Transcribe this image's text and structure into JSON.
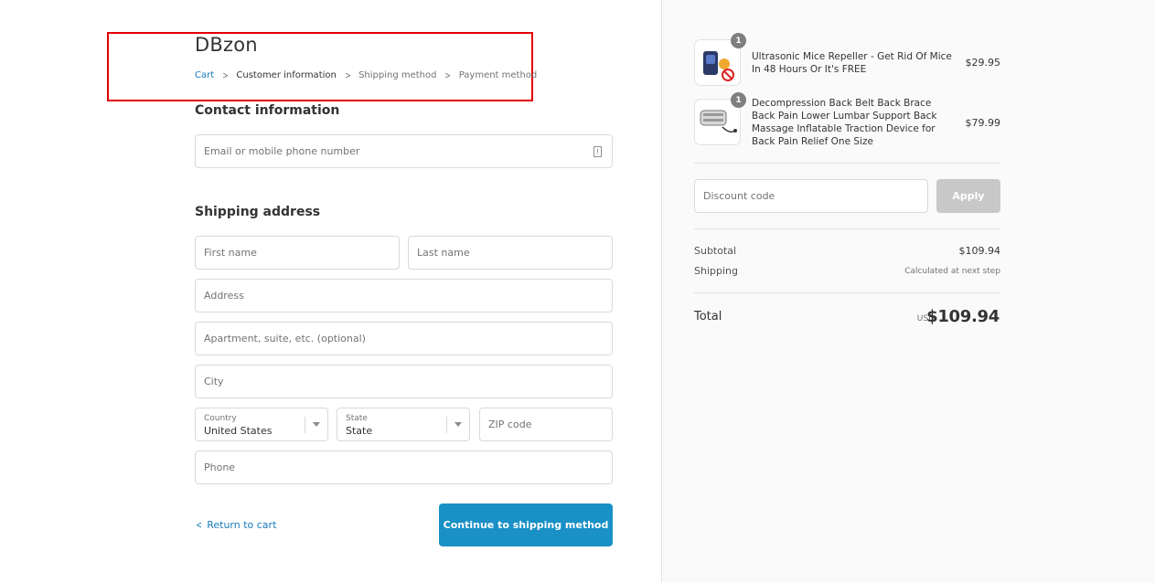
{
  "store": {
    "name": "DBzon"
  },
  "breadcrumb": [
    {
      "label": "Cart",
      "state": "link"
    },
    {
      "label": "Customer information",
      "state": "current"
    },
    {
      "label": "Shipping method",
      "state": "upcoming"
    },
    {
      "label": "Payment method",
      "state": "upcoming"
    }
  ],
  "contact": {
    "title": "Contact information",
    "email_placeholder": "Email or mobile phone number"
  },
  "shipping": {
    "title": "Shipping address",
    "first_name_placeholder": "First name",
    "last_name_placeholder": "Last name",
    "address_placeholder": "Address",
    "apartment_placeholder": "Apartment, suite, etc. (optional)",
    "city_placeholder": "City",
    "country": {
      "label": "Country",
      "value": "United States"
    },
    "state": {
      "label": "State",
      "value": "State"
    },
    "zip_placeholder": "ZIP code",
    "phone_placeholder": "Phone"
  },
  "actions": {
    "return_label": "Return to cart",
    "continue_label": "Continue to shipping method"
  },
  "order": {
    "items": [
      {
        "name": "Ultrasonic Mice Repeller - Get Rid Of Mice In 48 Hours Or It's FREE",
        "price": "$29.95",
        "quantity": "1"
      },
      {
        "name": "Decompression Back Belt Back Brace Back Pain Lower Lumbar Support Back Massage Inflatable Traction Device for Back Pain Relief One Size",
        "price": "$79.99",
        "quantity": "1"
      }
    ],
    "discount_placeholder": "Discount code",
    "apply_label": "Apply",
    "subtotal_label": "Subtotal",
    "subtotal_value": "$109.94",
    "shipping_label": "Shipping",
    "shipping_value": "Calculated at next step",
    "total_label": "Total",
    "currency": "USD",
    "total_value": "$109.94"
  },
  "colors": {
    "accent": "#1990c6",
    "link": "#197bbd",
    "highlight": "#e00000",
    "sidebar_bg": "#fafafa"
  }
}
